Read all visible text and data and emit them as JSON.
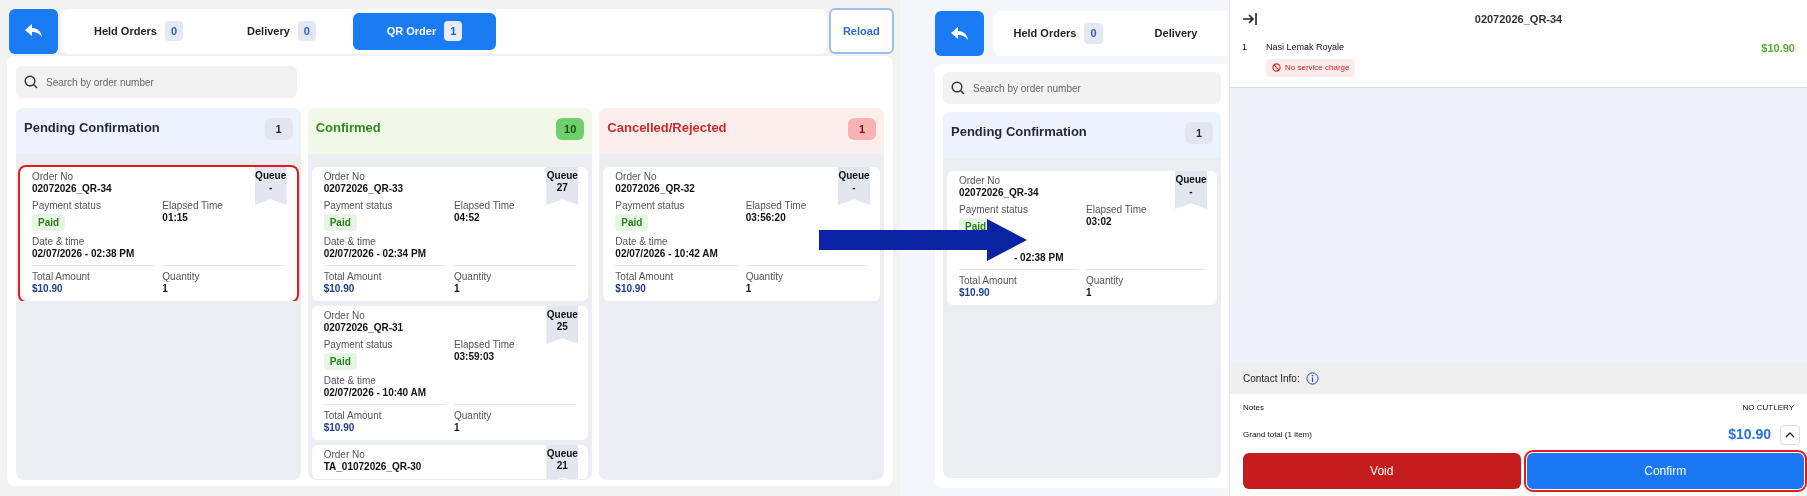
{
  "left_screen": {
    "tabs": [
      {
        "label": "Held Orders",
        "count": "0",
        "selected": false
      },
      {
        "label": "Delivery",
        "count": "0",
        "selected": false
      },
      {
        "label": "QR Order",
        "count": "1",
        "selected": true
      }
    ],
    "reload": "Reload",
    "search": {
      "placeholder": "Search by order number"
    },
    "columns": [
      {
        "kind": "pending",
        "title": "Pending Confirmation",
        "count": "1",
        "cards": [
          {
            "highlighted": true,
            "queue": {
              "label": "Queue",
              "value": "-"
            },
            "fields": [
              {
                "label": "Order No",
                "value": "02072026_QR-34"
              },
              {
                "label": "Payment status",
                "value": "Paid"
              },
              {
                "label": "Elapsed Time",
                "value": "01:15"
              },
              {
                "label": "Date & time",
                "value": "02/07/2026 - 02:38 PM"
              },
              {
                "label": "Total Amount",
                "value": "$10.90"
              },
              {
                "label": "Quantity",
                "value": "1"
              }
            ]
          }
        ]
      },
      {
        "kind": "confirmed",
        "title": "Confirmed",
        "count": "10",
        "cards": [
          {
            "highlighted": false,
            "queue": {
              "label": "Queue",
              "value": "27"
            },
            "fields": [
              {
                "label": "Order No",
                "value": "02072026_QR-33"
              },
              {
                "label": "Payment status",
                "value": "Paid"
              },
              {
                "label": "Elapsed Time",
                "value": "04:52"
              },
              {
                "label": "Date & time",
                "value": "02/07/2026 - 02:34 PM"
              },
              {
                "label": "Total Amount",
                "value": "$10.90"
              },
              {
                "label": "Quantity",
                "value": "1"
              }
            ]
          },
          {
            "highlighted": false,
            "queue": {
              "label": "Queue",
              "value": "25"
            },
            "fields": [
              {
                "label": "Order No",
                "value": "02072026_QR-31"
              },
              {
                "label": "Payment status",
                "value": "Paid"
              },
              {
                "label": "Elapsed Time",
                "value": "03:59:03"
              },
              {
                "label": "Date & time",
                "value": "02/07/2026 - 10:40 AM"
              },
              {
                "label": "Total Amount",
                "value": "$10.90"
              },
              {
                "label": "Quantity",
                "value": "1"
              }
            ]
          },
          {
            "highlighted": false,
            "queue": {
              "label": "Queue",
              "value": "21"
            },
            "fields": [
              {
                "label": "Order No",
                "value": "TA_01072026_QR-30"
              }
            ]
          }
        ]
      },
      {
        "kind": "cancelled",
        "title": "Cancelled/Rejected",
        "count": "1",
        "cards": [
          {
            "highlighted": false,
            "queue": {
              "label": "Queue",
              "value": "-"
            },
            "fields": [
              {
                "label": "Order No",
                "value": "02072026_QR-32"
              },
              {
                "label": "Payment status",
                "value": "Paid"
              },
              {
                "label": "Elapsed Time",
                "value": "03:56:20"
              },
              {
                "label": "Date & time",
                "value": "02/07/2026 - 10:42 AM"
              },
              {
                "label": "Total Amount",
                "value": "$10.90"
              },
              {
                "label": "Quantity",
                "value": "1"
              }
            ]
          }
        ]
      }
    ]
  },
  "right_screen": {
    "tabs": [
      {
        "label": "Held Orders",
        "count": "0",
        "selected": false
      },
      {
        "label": "Delivery",
        "selected": false
      }
    ],
    "search": {
      "placeholder": "Search by order number"
    },
    "columns": [
      {
        "kind": "pending",
        "title": "Pending Confirmation",
        "count": "1",
        "cards": [
          {
            "highlighted": false,
            "queue": {
              "label": "Queue",
              "value": "-"
            },
            "fields": [
              {
                "label": "Order No",
                "value": "02072026_QR-34"
              },
              {
                "label": "Payment status",
                "value": "Paid"
              },
              {
                "label": "Elapsed Time",
                "value": "03:02"
              },
              {
                "value": "- 02:38 PM"
              },
              {
                "label": "Total Amount",
                "value": "$10.90"
              },
              {
                "label": "Quantity",
                "value": "1"
              }
            ]
          }
        ]
      }
    ]
  },
  "order_panel": {
    "title": "02072026_QR-34",
    "items": [
      {
        "qty": "1",
        "name": "Nasi Lemak Royale",
        "price": "$10.90",
        "tag": "No service charge"
      }
    ],
    "contact_label": "Contact Info:",
    "notes_label": "Notes",
    "notes": "NO CUTLERY",
    "total_label": "Grand total (1 item)",
    "total": "$10.90",
    "buttons": [
      {
        "kind": "void",
        "label": "Void",
        "highlighted": false
      },
      {
        "kind": "confirm",
        "label": "Confirm",
        "highlighted": true
      }
    ]
  }
}
